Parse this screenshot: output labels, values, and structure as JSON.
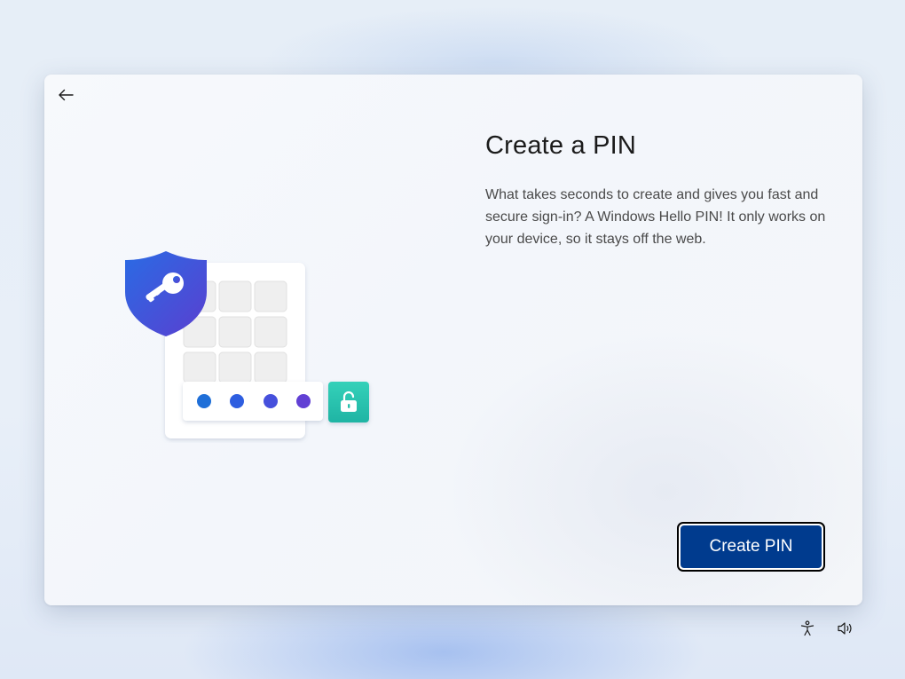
{
  "page": {
    "title": "Create a PIN",
    "description": "What takes seconds to create and gives you fast and secure sign-in? A Windows Hello PIN! It only works on your device, so it stays off the web."
  },
  "navigation": {
    "back_icon": "arrow-left-icon"
  },
  "actions": {
    "create_pin_label": "Create PIN"
  },
  "system_tray": {
    "accessibility_icon": "accessibility-icon",
    "volume_icon": "volume-icon"
  },
  "illustration": {
    "pin_dots_entered": 4,
    "icons": [
      "shield-key-icon",
      "keypad-icon",
      "unlocked-padlock-icon"
    ]
  },
  "colors": {
    "button_fill": "#003b8e",
    "shield_blue": "#2f5fe0",
    "shield_purple": "#5b4bd6",
    "lock_teal": "#2bc4b0"
  }
}
